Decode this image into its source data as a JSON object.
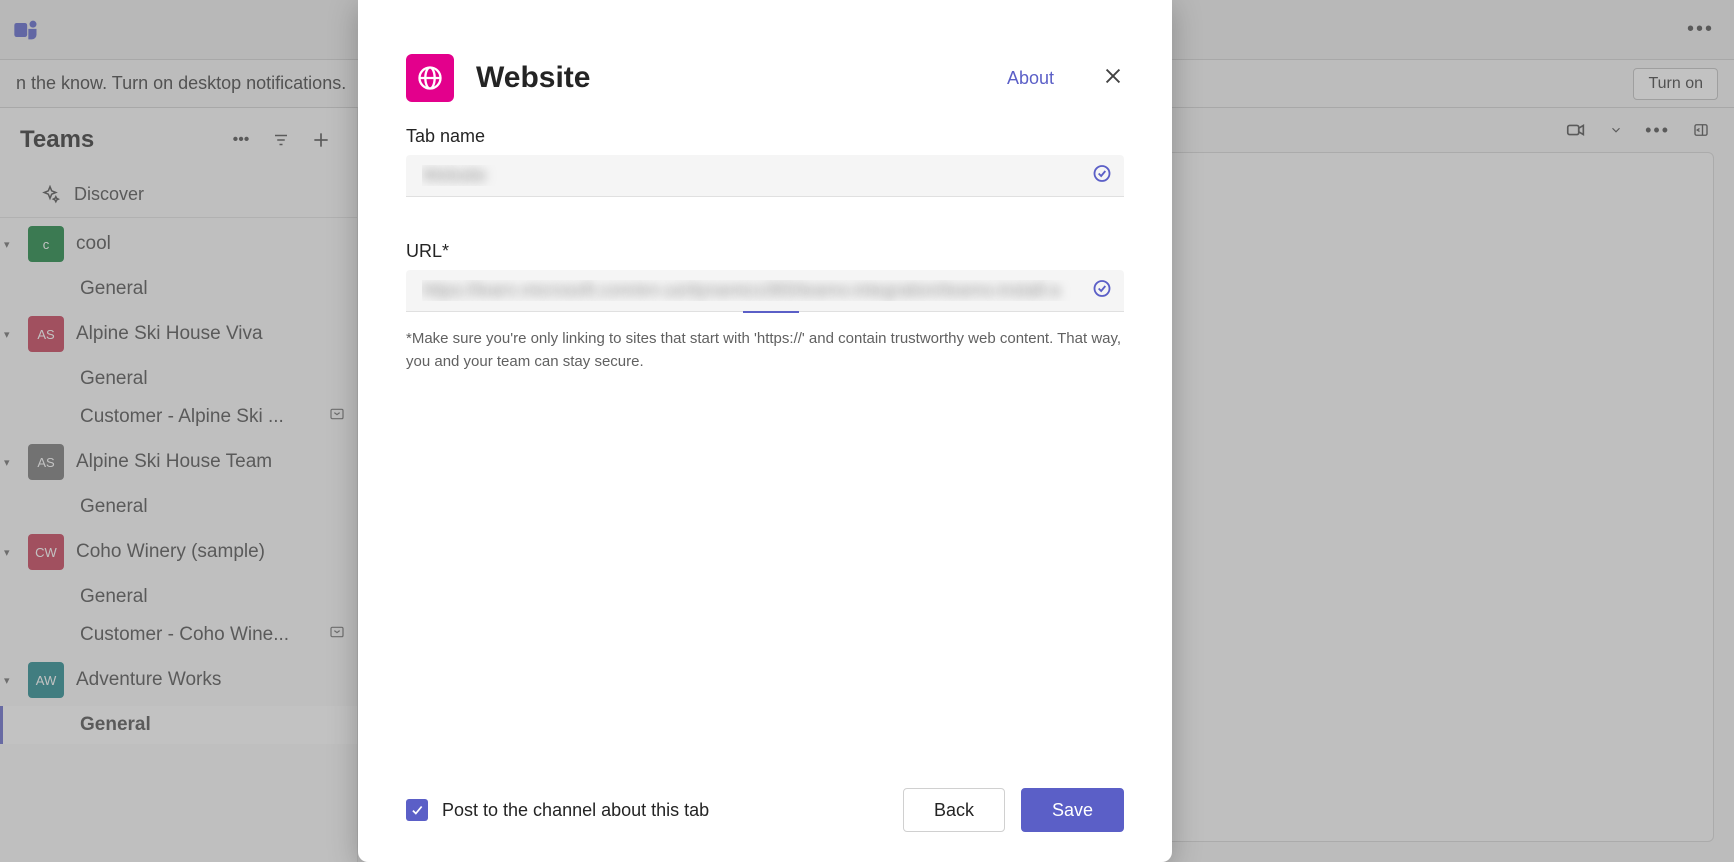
{
  "notification": {
    "text": "n the know. Turn on desktop notifications.",
    "turn_on": "Turn on"
  },
  "sidebar": {
    "title": "Teams",
    "discover": "Discover",
    "teams": [
      {
        "name": "cool",
        "avatar_text": "c",
        "avatar_bg": "#0a7d33",
        "channels": [
          {
            "name": "General",
            "active": false,
            "shared": false
          }
        ]
      },
      {
        "name": "Alpine Ski House Viva",
        "avatar_text": "AS",
        "avatar_bg": "#c4314b",
        "channels": [
          {
            "name": "General",
            "active": false,
            "shared": false
          },
          {
            "name": "Customer - Alpine Ski ...",
            "active": false,
            "shared": true
          }
        ]
      },
      {
        "name": "Alpine Ski House Team",
        "avatar_text": "AS",
        "avatar_bg": "#6e6e6e",
        "channels": [
          {
            "name": "General",
            "active": false,
            "shared": false
          }
        ]
      },
      {
        "name": "Coho Winery (sample)",
        "avatar_text": "CW",
        "avatar_bg": "#c4314b",
        "channels": [
          {
            "name": "General",
            "active": false,
            "shared": false
          },
          {
            "name": "Customer - Coho Wine...",
            "active": false,
            "shared": true
          }
        ]
      },
      {
        "name": "Adventure Works",
        "avatar_text": "AW",
        "avatar_bg": "#148287",
        "channels": [
          {
            "name": "General",
            "active": true,
            "shared": false
          }
        ]
      }
    ]
  },
  "modal": {
    "title": "Website",
    "about": "About",
    "tab_name_label": "Tab name",
    "tab_name_value": "Website",
    "url_label": "URL*",
    "url_value": "https://learn.microsoft.com/en-us/dynamics365/teams-integration/teams-install-a",
    "help": "*Make sure you're only linking to sites that start with 'https://' and contain trustworthy web content. That way, you and your team can stay secure.",
    "post_checkbox_label": "Post to the channel about this tab",
    "post_checked": true,
    "back": "Back",
    "save": "Save"
  }
}
